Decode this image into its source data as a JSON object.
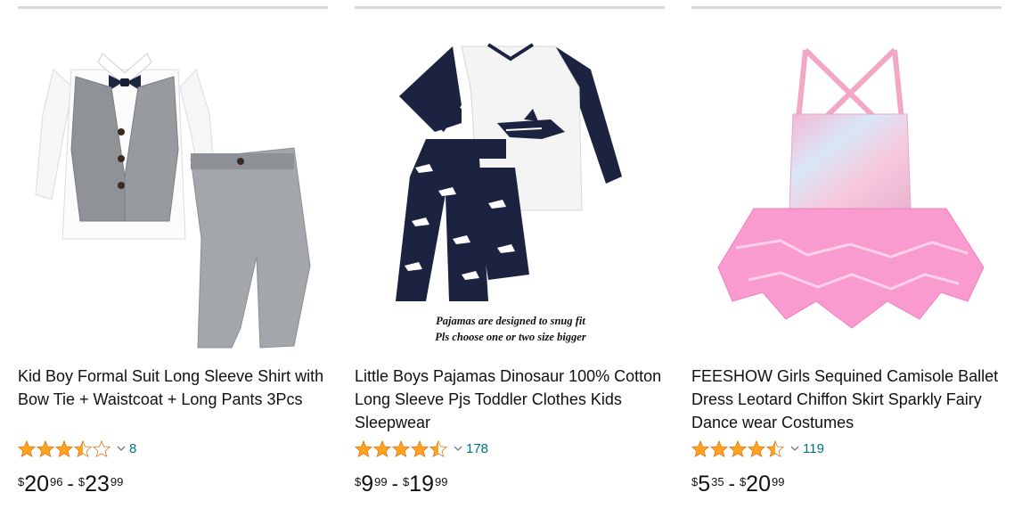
{
  "products": [
    {
      "title": "Kid Boy Formal Suit Long Sleeve Shirt with Bow Tie + Waistcoat + Long Pants 3Pcs",
      "rating": 3.5,
      "review_count": "8",
      "price_low": {
        "symbol": "$",
        "whole": "20",
        "fraction": "96"
      },
      "price_separator": "-",
      "price_high": {
        "symbol": "$",
        "whole": "23",
        "fraction": "99"
      }
    },
    {
      "title": "Little Boys Pajamas Dinosaur 100% Cotton Long Sleeve Pjs Toddler Clothes Kids Sleepwear",
      "rating": 4.5,
      "review_count": "178",
      "image_caption_line1": "Pajamas are designed to snug fit",
      "image_caption_line2": "Pls choose one or two size bigger",
      "price_low": {
        "symbol": "$",
        "whole": "9",
        "fraction": "99"
      },
      "price_separator": "-",
      "price_high": {
        "symbol": "$",
        "whole": "19",
        "fraction": "99"
      }
    },
    {
      "title": "FEESHOW Girls Sequined Camisole Ballet Dress Leotard Chiffon Skirt Sparkly Fairy Dance wear Costumes",
      "rating": 4.5,
      "review_count": "119",
      "price_low": {
        "symbol": "$",
        "whole": "5",
        "fraction": "35"
      },
      "price_separator": "-",
      "price_high": {
        "symbol": "$",
        "whole": "20",
        "fraction": "99"
      }
    }
  ],
  "colors": {
    "star_fill": "#ffa41c",
    "star_stroke": "#de7921",
    "link": "#007185",
    "divider": "#d5d9d9",
    "text": "#0f1111"
  },
  "icons": {
    "star": "star-icon",
    "chevron": "chevron-down-icon"
  }
}
